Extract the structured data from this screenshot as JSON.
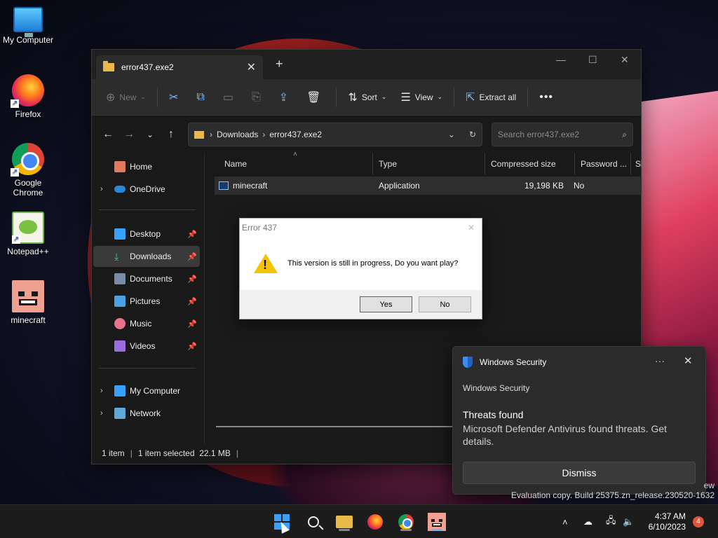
{
  "desktop": {
    "icons": [
      {
        "label": "My Computer",
        "icon": "monitor-icon"
      },
      {
        "label": "Firefox",
        "icon": "firefox-icon"
      },
      {
        "label": "Google Chrome",
        "icon": "chrome-icon"
      },
      {
        "label": "Notepad++",
        "icon": "notepad-icon"
      },
      {
        "label": "minecraft",
        "icon": "minecraft-icon"
      }
    ]
  },
  "explorer": {
    "tab_title": "error437.exe2",
    "toolbar": {
      "new": "New",
      "sort": "Sort",
      "view": "View",
      "extract_all": "Extract all"
    },
    "breadcrumb": [
      "Downloads",
      "error437.exe2"
    ],
    "search_placeholder": "Search error437.exe2",
    "sidebar": {
      "home": "Home",
      "onedrive": "OneDrive",
      "desktop": "Desktop",
      "downloads": "Downloads",
      "documents": "Documents",
      "pictures": "Pictures",
      "music": "Music",
      "videos": "Videos",
      "my_computer": "My Computer",
      "network": "Network"
    },
    "columns": {
      "name": "Name",
      "type": "Type",
      "compressed_size": "Compressed size",
      "password": "Password ...",
      "size": "Si"
    },
    "rows": [
      {
        "name": "minecraft",
        "type": "Application",
        "compressed_size": "19,198 KB",
        "password": "No"
      }
    ],
    "status": {
      "count": "1 item",
      "selected": "1 item selected  22.1 MB"
    }
  },
  "dialog": {
    "title": "Error 437",
    "message": "This version is still in progress, Do you want play?",
    "yes": "Yes",
    "no": "No"
  },
  "toast": {
    "header": "Windows Security",
    "app": "Windows Security",
    "heading": "Threats found",
    "message": "Microsoft Defender Antivirus found threats. Get details.",
    "dismiss": "Dismiss"
  },
  "watermark": {
    "line1": "ew",
    "line2": "Evaluation copy. Build 25375.zn_release.230520-1632"
  },
  "taskbar": {
    "time": "4:37 AM",
    "date": "6/10/2023",
    "notifications": "4"
  }
}
